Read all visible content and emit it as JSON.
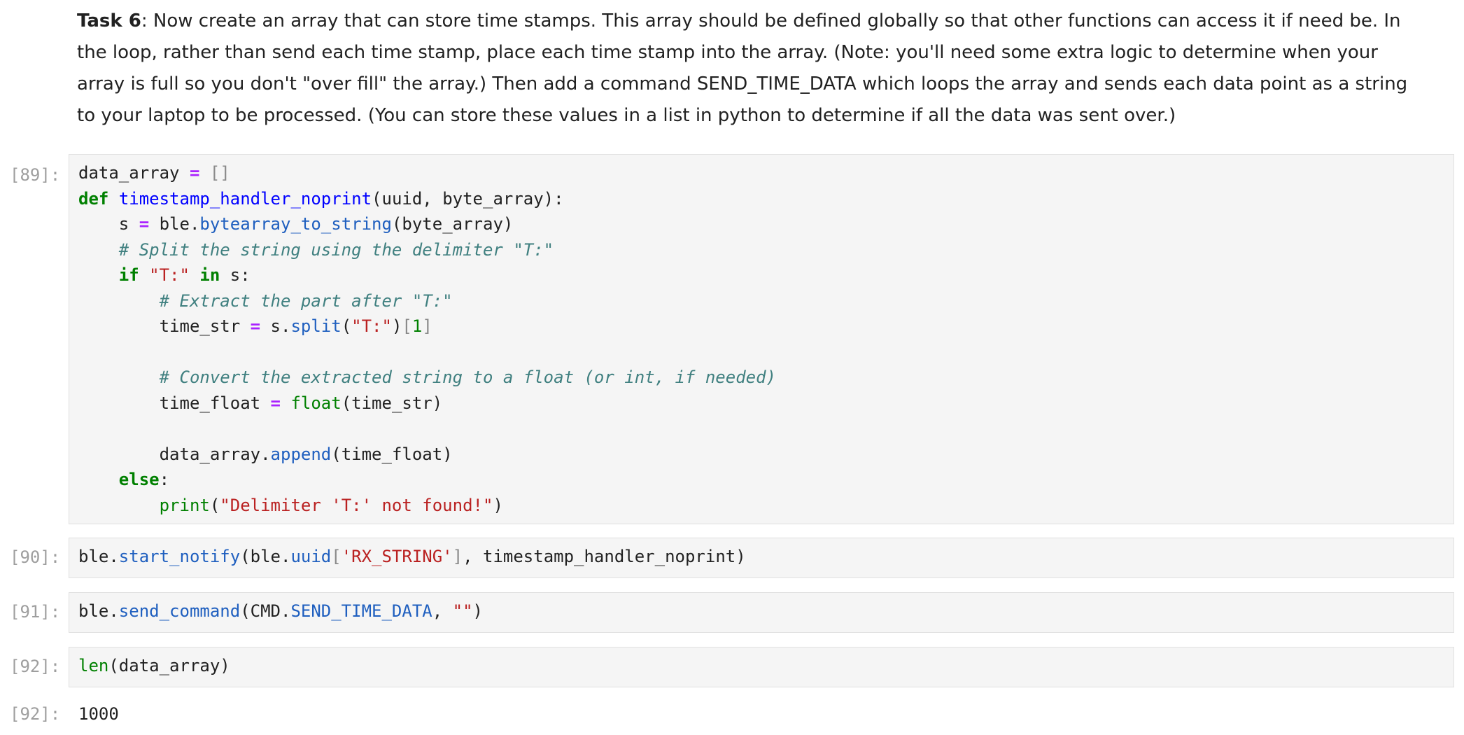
{
  "markdown": {
    "task_label": "Task 6",
    "task_text": ": Now create an array that can store time stamps. This array should be defined globally so that other functions can access it if need be. In the loop, rather than send each time stamp, place each time stamp into the array. (Note: you'll need some extra logic to determine when your array is full so you don't \"over fill\" the array.) Then add a command SEND_TIME_DATA which loops the array and sends each data point as a string to your laptop to be processed. (You can store these values in a list in python to determine if all the data was sent over.)"
  },
  "cells": [
    {
      "prompt": "[89]:"
    },
    {
      "prompt": "[90]:"
    },
    {
      "prompt": "[91]:"
    },
    {
      "prompt": "[92]:"
    }
  ],
  "code": {
    "c89": {
      "var_data_array": "data_array",
      "eq": "=",
      "empty_list": "[]",
      "def": "def",
      "func_name": "timestamp_handler_noprint",
      "params": "(uuid, byte_array):",
      "s": "s",
      "ble": "ble.",
      "bytearray_to_string": "bytearray_to_string",
      "byte_array_arg": "(byte_array)",
      "comment_split": "# Split the string using the delimiter \"T:\"",
      "if": "if",
      "t_str": "\"T:\"",
      "in": "in",
      "s_colon": "s:",
      "comment_extract": "# Extract the part after \"T:\"",
      "time_str": "time_str",
      "s_dot": "s.",
      "split": "split",
      "paren_open": "(",
      "paren_close": ")",
      "idx_open": "[",
      "idx_one": "1",
      "idx_close": "]",
      "comment_convert": "# Convert the extracted string to a float (or int, if needed)",
      "time_float": "time_float",
      "float": "float",
      "time_str_arg": "(time_str)",
      "data_array_dot": "data_array.",
      "append": "append",
      "time_float_arg": "(time_float)",
      "else": "else",
      "colon": ":",
      "print": "print",
      "not_found": "\"Delimiter 'T:' not found!\""
    },
    "c90": {
      "ble": "ble.",
      "start_notify": "start_notify",
      "open": "(ble.",
      "uuid": "uuid",
      "br_open": "[",
      "rx_string": "'RX_STRING'",
      "br_close": "]",
      "rest": ", timestamp_handler_noprint)"
    },
    "c91": {
      "ble": "ble.",
      "send_command": "send_command",
      "open": "(CMD.",
      "send_time_data": "SEND_TIME_DATA",
      "comma": ", ",
      "empty_str": "\"\"",
      "close": ")"
    },
    "c92": {
      "len": "len",
      "arg": "(data_array)"
    }
  },
  "outputs": [
    {
      "prompt": "[92]:",
      "text": "1000"
    }
  ]
}
